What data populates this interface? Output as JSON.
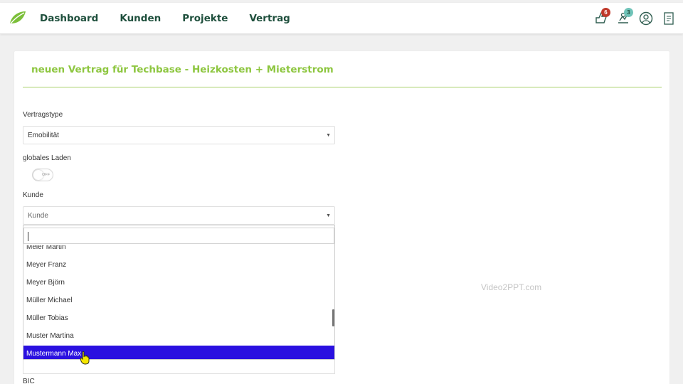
{
  "nav": {
    "items": [
      {
        "label": "Dashboard"
      },
      {
        "label": "Kunden"
      },
      {
        "label": "Projekte"
      },
      {
        "label": "Vertrag"
      }
    ],
    "icons": [
      {
        "name": "thumb-icon",
        "badge": "6",
        "badge_color": "#c0392b"
      },
      {
        "name": "tasks-icon",
        "badge": "3",
        "badge_color": "#2a9d8f"
      },
      {
        "name": "user-icon"
      },
      {
        "name": "document-icon"
      }
    ]
  },
  "card": {
    "title": "neuen Vertrag für Techbase - Heizkosten + Mieterstrom"
  },
  "form": {
    "vertragstype_label": "Vertragstype",
    "vertragstype_value": "Emobilität",
    "globales_laden_label": "globales Laden",
    "toggle_text": "OFF",
    "kunde_label": "Kunde",
    "kunde_placeholder": "Kunde",
    "bic_label": "BIC"
  },
  "dropdown": {
    "items": [
      {
        "label": "Meier Martin"
      },
      {
        "label": "Meyer Franz"
      },
      {
        "label": "Meyer Björn"
      },
      {
        "label": "Müller Michael"
      },
      {
        "label": "Müller Tobias"
      },
      {
        "label": "Muster Martina"
      },
      {
        "label": "Mustermann Max",
        "selected": true
      }
    ]
  },
  "watermark": "Video2PPT.com",
  "colors": {
    "nav_text": "#1e4f3c",
    "title_green": "#8dc63f",
    "selected_bg": "#2a10e0"
  }
}
